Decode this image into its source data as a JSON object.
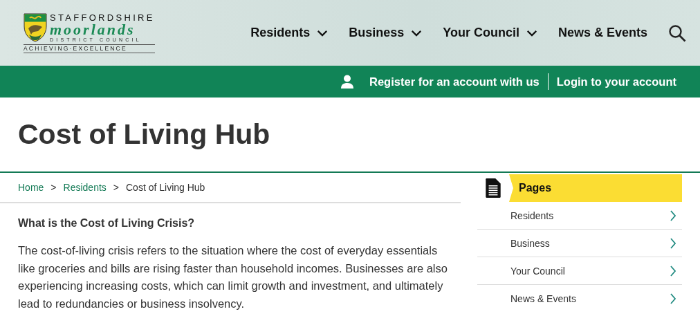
{
  "logo": {
    "line_1": "STAFFORDSHIRE",
    "line_2": "moorlands",
    "line_3": "DISTRICT COUNCIL",
    "tagline": "ACHIEVING·EXCELLENCE"
  },
  "nav": [
    {
      "label": "Residents",
      "has_menu": true
    },
    {
      "label": "Business",
      "has_menu": true
    },
    {
      "label": "Your Council",
      "has_menu": true
    },
    {
      "label": "News & Events",
      "has_menu": false
    }
  ],
  "account_bar": {
    "register": "Register for an account with us",
    "login": "Login to your account"
  },
  "page_title": "Cost of Living Hub",
  "breadcrumbs": [
    {
      "label": "Home",
      "current": false
    },
    {
      "label": "Residents",
      "current": false
    },
    {
      "label": "Cost of Living Hub",
      "current": true
    }
  ],
  "breadcrumb_separator": ">",
  "article": {
    "heading": "What is the Cost of Living Crisis?",
    "paragraph": "The cost-of-living crisis refers to the situation where the cost of everyday essentials like groceries and bills are rising faster than household incomes. Businesses are also experiencing increasing costs, which can limit growth and investment, and ultimately lead to redundancies or business insolvency."
  },
  "sidebar": {
    "title": "Pages",
    "items": [
      {
        "label": "Residents"
      },
      {
        "label": "Business"
      },
      {
        "label": "Your Council"
      },
      {
        "label": "News & Events"
      }
    ]
  }
}
